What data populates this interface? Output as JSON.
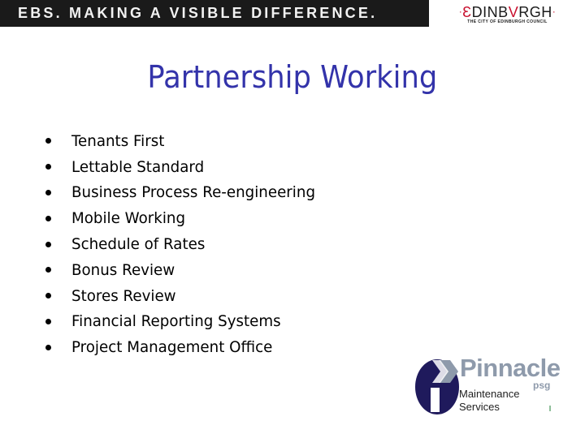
{
  "header": {
    "banner_text": "EBS. MAKING A VISIBLE DIFFERENCE.",
    "council_logo": {
      "name_prefix": "·",
      "name_first": "Ɛ",
      "name_mid": "DINB",
      "name_v": "V",
      "name_end": "RGH",
      "name_suffix": "·",
      "subtitle": "THE CITY OF EDINBURGH COUNCIL"
    }
  },
  "slide": {
    "title": "Partnership Working",
    "bullets": [
      "Tenants First",
      "Lettable Standard",
      "Business Process Re-engineering",
      "Mobile Working",
      "Schedule of Rates",
      "Bonus Review",
      "Stores Review",
      "Financial Reporting Systems",
      "Project Management Office"
    ]
  },
  "footer_logo": {
    "name": "Pinnacle",
    "suffix": "psg",
    "tagline_line1": "Maintenance",
    "tagline_line2": "Services",
    "icon": "pinnacle-i-arrow-icon"
  },
  "colors": {
    "title": "#3333aa",
    "banner_bg": "#1a1a1a",
    "council_red": "#c8102e",
    "pinnacle_navy": "#1f1a5c",
    "pinnacle_grey": "#8e9aab"
  }
}
